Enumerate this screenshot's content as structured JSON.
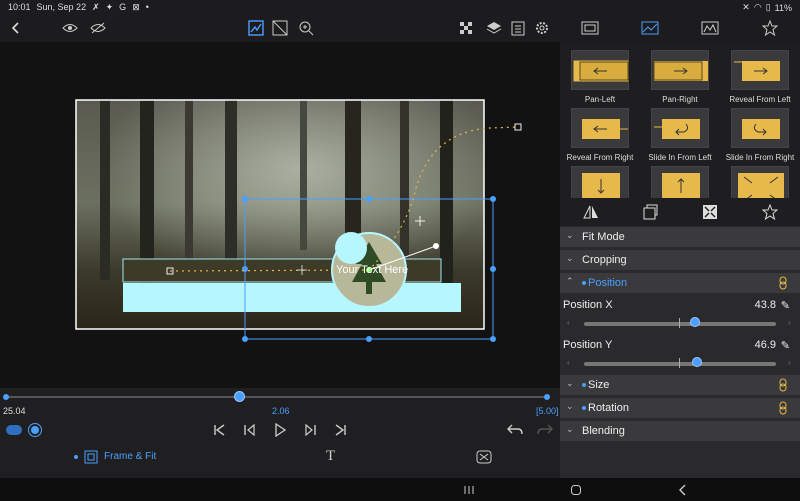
{
  "status_bar": {
    "time": "10:01",
    "date": "Sun, Sep 22",
    "notif_icons": [
      "✗",
      "✦",
      "G",
      "⊠",
      "•"
    ],
    "battery": "11%"
  },
  "toolbar": {
    "back_icon": "chevron-left-icon",
    "eye_icon": "eye-icon",
    "eye_slash_icon": "eye-slash-icon",
    "keyframe_mode_icon": "keyframe-path-icon",
    "crop_icon": "crop-icon",
    "zoom_icon": "zoom-plus-icon",
    "grid_icon": "grid-icon",
    "layers_icon": "layers-icon",
    "clipboard_icon": "clipboard-icon",
    "settings_icon": "gear-icon"
  },
  "right_tabs": [
    "frame-tab",
    "image-tab",
    "histogram-tab",
    "favorites-tab"
  ],
  "canvas": {
    "overlay_text": "Your Text Here"
  },
  "timeline": {
    "start_time": "25.04",
    "current_time": "2.06",
    "end_time": "[5.00]",
    "progress": 0.43
  },
  "controls": {
    "frame_fit_label": "Frame & Fit"
  },
  "presets": [
    {
      "label": "Pan-Left"
    },
    {
      "label": "Pan-Right"
    },
    {
      "label": "Reveal From Left"
    },
    {
      "label": "Reveal From Right"
    },
    {
      "label": "Slide In From Left"
    },
    {
      "label": "Slide In From Right"
    },
    {
      "label": ""
    },
    {
      "label": ""
    },
    {
      "label": ""
    }
  ],
  "sections": {
    "fit_mode": "Fit Mode",
    "cropping": "Cropping",
    "position": "Position",
    "size": "Size",
    "rotation": "Rotation",
    "blending": "Blending"
  },
  "params": {
    "position_x": {
      "label": "Position X",
      "value": "43.8",
      "level": 0.58
    },
    "position_y": {
      "label": "Position Y",
      "value": "46.9",
      "level": 0.59
    }
  },
  "colors": {
    "accent": "#4a9fff",
    "gold": "#e6b94a",
    "cyan": "#b6f6ff",
    "panel": "#2a2a2c"
  }
}
